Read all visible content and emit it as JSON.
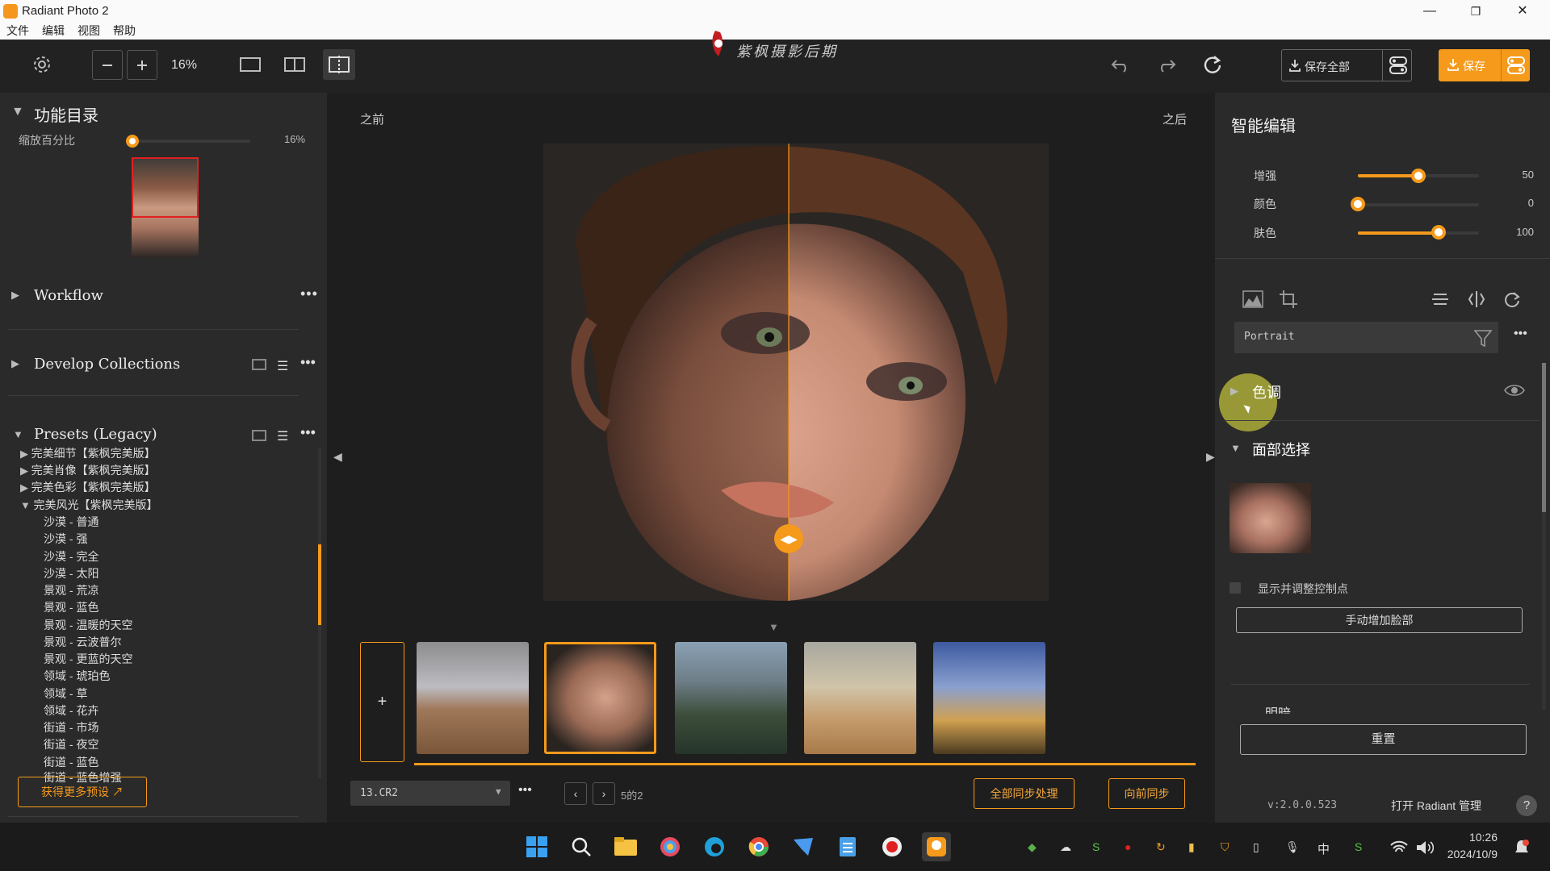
{
  "window": {
    "title": "Radiant Photo 2",
    "minimize": "—",
    "restore": "❐",
    "close": "✕"
  },
  "menu": [
    "文件",
    "编辑",
    "视图",
    "帮助"
  ],
  "watermark": "紫枫摄影后期",
  "toolbar": {
    "zoom": "16%",
    "save_all": "保存全部",
    "save": "保存",
    "accent": "#f59a1b"
  },
  "left": {
    "catalog_title": "功能目录",
    "zoom_label": "缩放百分比",
    "zoom_value": "16%",
    "zoom_fraction": 0.0,
    "workflow": "Workflow",
    "develop_collections": "Develop Collections",
    "presets_title": "Presets (Legacy)",
    "preset_groups": [
      "完美细节【紫枫完美版】",
      "完美肖像【紫枫完美版】",
      "完美色彩【紫枫完美版】",
      "完美风光【紫枫完美版】"
    ],
    "preset_items": [
      "沙漠 - 普通",
      "沙漠 - 强",
      "沙漠 - 完全",
      "沙漠 - 太阳",
      "景观 - 荒凉",
      "景观 - 蓝色",
      "景观 - 温暖的天空",
      "景观 - 云波普尔",
      "景观 - 更蓝的天空",
      "领域 - 琥珀色",
      "领域 - 草",
      "领域 - 花卉",
      "街道 - 市场",
      "街道 - 夜空",
      "街道 - 蓝色",
      "街道 - 蓝色增强"
    ],
    "more_presets": "获得更多预设"
  },
  "center": {
    "before": "之前",
    "after": "之后",
    "add_icon": "+",
    "filename": "13.CR2",
    "counter": "5的2",
    "sync_all": "全部同步处理",
    "sync_forward": "向前同步"
  },
  "right": {
    "title": "智能编辑",
    "sliders": [
      {
        "label": "增强",
        "value": "50",
        "fraction": 0.5
      },
      {
        "label": "颜色",
        "value": "0",
        "fraction": 0.0
      },
      {
        "label": "肤色",
        "value": "100",
        "fraction": 0.67
      }
    ],
    "preset_select": "Portrait",
    "tone_section": "色调",
    "face_section": "面部选择",
    "show_points": "显示并调整控制点",
    "add_face": "手动增加脸部",
    "next_section": "明暗",
    "reset": "重置",
    "version": "v:2.0.0.523",
    "open_manager": "打开 Radiant 管理",
    "help": "?"
  },
  "taskbar": {
    "ime": "中",
    "time": "10:26",
    "date": "2024/10/9"
  }
}
